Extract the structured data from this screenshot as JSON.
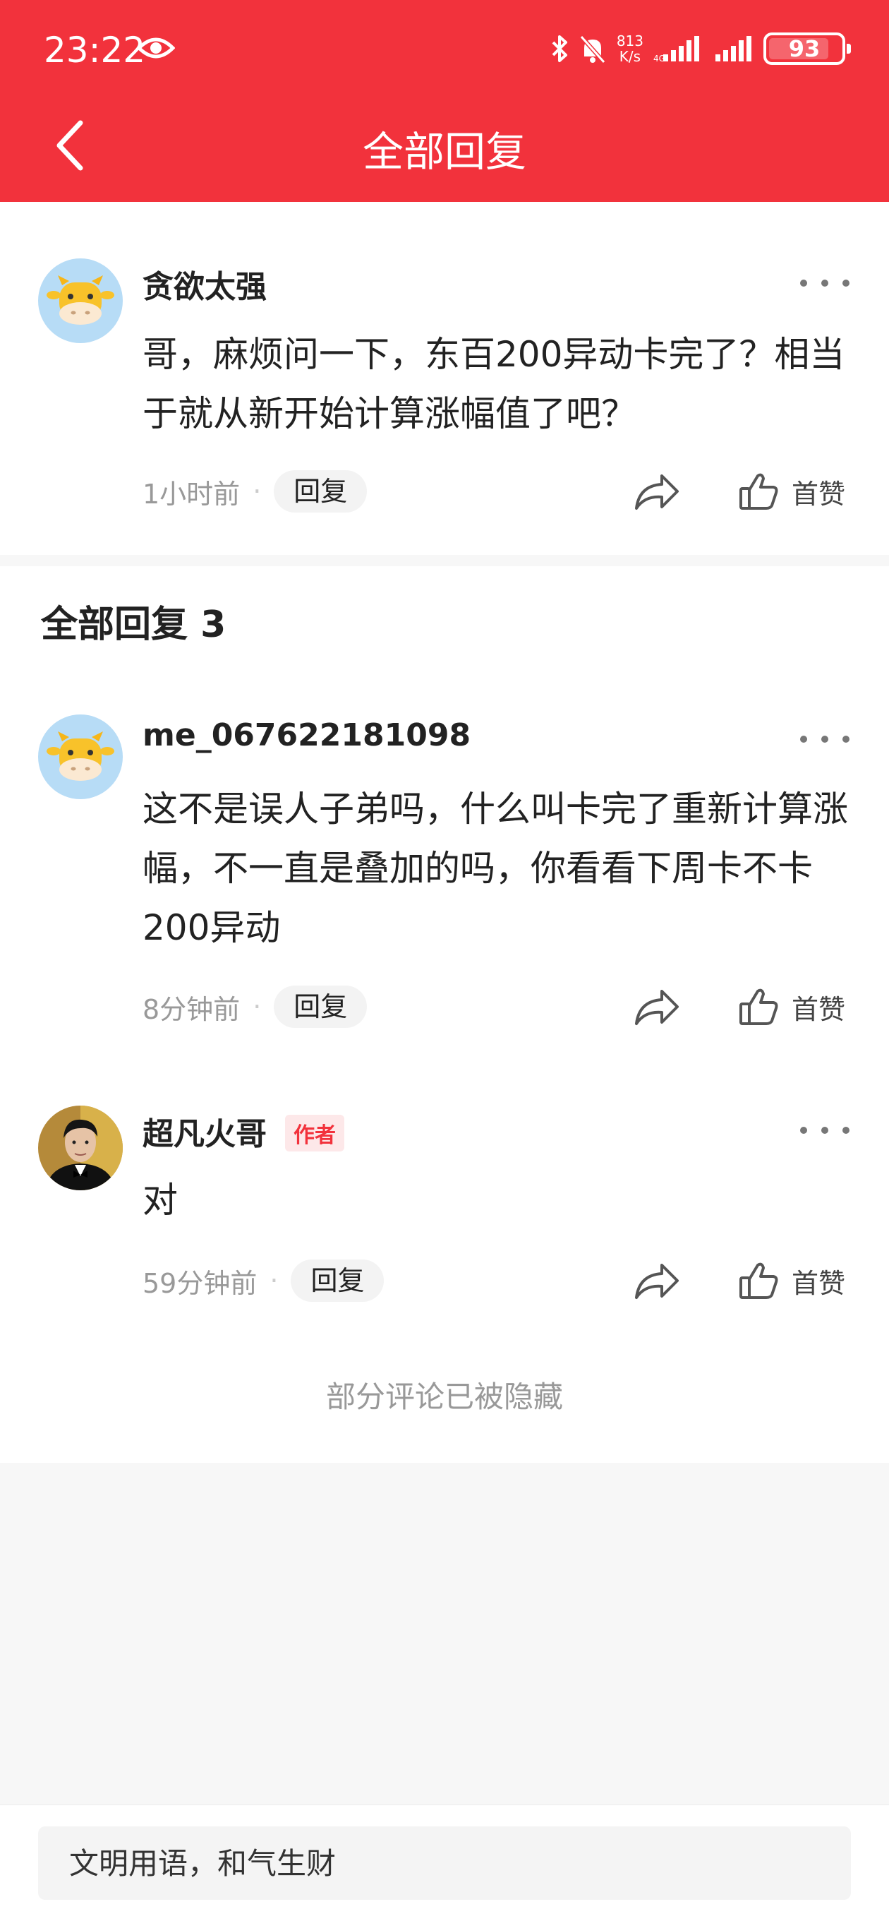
{
  "status_bar": {
    "time": "23:22",
    "net_speed_value": "813",
    "net_speed_unit": "K/s",
    "battery": "93",
    "battery_level": 0.93,
    "icons": [
      "eye-icon",
      "bluetooth-icon",
      "mute-bell-icon",
      "signal-icon",
      "signal-icon"
    ]
  },
  "header": {
    "title": "全部回复",
    "back_icon": "chevron-left-icon",
    "color": "#f2323c"
  },
  "main_comment": {
    "username": "贪欲太强",
    "content": "哥，麻烦问一下，东百200异动卡完了？相当于就从新开始计算涨幅值了吧？",
    "time": "1小时前",
    "dot": "·",
    "reply_label": "回复",
    "like_label": "首赞",
    "avatar_icon": "cow-avatar-icon"
  },
  "replies_section": {
    "title": "全部回复 3",
    "items": [
      {
        "username": "me_067622181098",
        "content": "这不是误人子弟吗，什么叫卡完了重新计算涨幅，不一直是叠加的吗，你看看下周卡不卡200异动",
        "time": "8分钟前",
        "dot": "·",
        "reply_label": "回复",
        "like_label": "首赞",
        "avatar_icon": "cow-avatar-icon"
      },
      {
        "username": "超凡火哥",
        "badge": "作者",
        "content": "对",
        "time": "59分钟前",
        "dot": "·",
        "reply_label": "回复",
        "like_label": "首赞",
        "avatar_icon": "portrait-avatar-icon"
      }
    ],
    "hidden_note": "部分评论已被隐藏"
  },
  "input": {
    "placeholder": "文明用语，和气生财"
  }
}
